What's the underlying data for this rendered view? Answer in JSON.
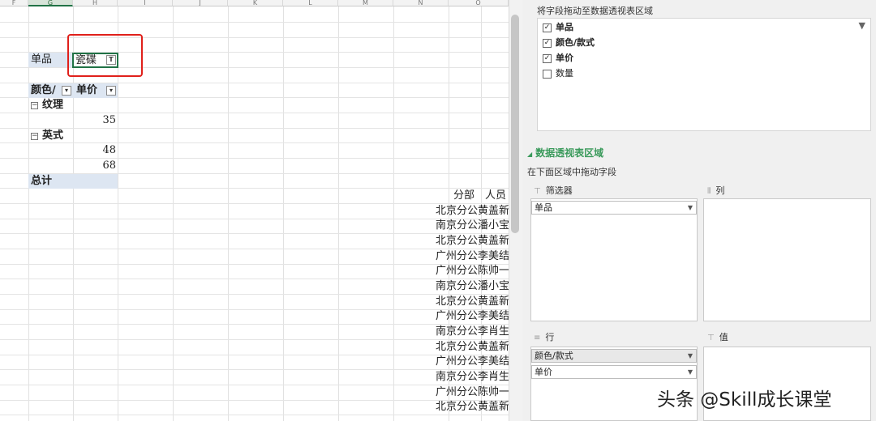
{
  "spreadsheet": {
    "columns": [
      "F",
      "G",
      "H",
      "I",
      "J",
      "K",
      "L",
      "M",
      "N",
      "O"
    ],
    "filter": {
      "field_label": "单品",
      "value": "瓷碟",
      "dropdown_icon": "filter-dropdown-icon"
    },
    "pivot": {
      "header_col1": "颜色/",
      "header_col2": "单价",
      "group1": "纹理",
      "group1_values": [
        "35"
      ],
      "group2": "英式",
      "group2_values": [
        "48",
        "68"
      ],
      "total_label": "总计"
    },
    "side_table": {
      "headers": [
        "分部",
        "人员"
      ],
      "rows": [
        "北京分公黄盖新",
        "南京分公潘小宝",
        "北京分公黄盖新",
        "广州分公李美结",
        "广州分公陈帅一",
        "南京分公潘小宝",
        "北京分公黄盖新",
        "广州分公李美结",
        "南京分公李肖生",
        "北京分公黄盖新",
        "广州分公李美结",
        "南京分公李肖生",
        "广州分公陈帅一",
        "北京分公黄盖新"
      ]
    },
    "highlight_color": "#e0201b"
  },
  "panel": {
    "field_list_title": "将字段拖动至数据透视表区域",
    "fields": [
      {
        "label": "单品",
        "checked": true
      },
      {
        "label": "颜色/款式",
        "checked": true
      },
      {
        "label": "单价",
        "checked": true
      },
      {
        "label": "数量",
        "checked": false
      }
    ],
    "areas_title": "数据透视表区域",
    "areas_hint": "在下面区域中拖动字段",
    "filters_label": "筛选器",
    "columns_label": "列",
    "rows_label": "行",
    "values_label": "值",
    "filters_items": [
      "单品"
    ],
    "rows_items": [
      "颜色/款式",
      "单价"
    ],
    "accent_color": "#3a9a5b"
  },
  "watermark": "头条 @Skill成长课堂"
}
